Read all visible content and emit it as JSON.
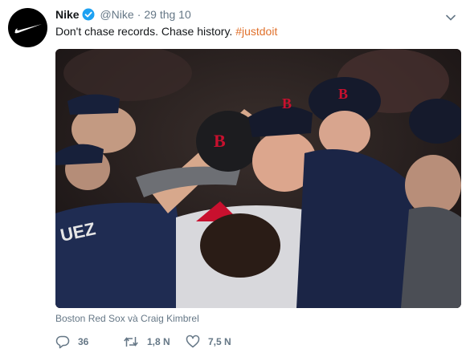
{
  "tweet": {
    "name": "Nike",
    "handle": "@Nike",
    "separator": "·",
    "time": "29 thg 10",
    "text_main": "Don't chase records. Chase history. ",
    "hashtag": "#justdoit",
    "caption": "Boston Red Sox và Craig Kimbrel",
    "replies": "36",
    "retweets": "1,8 N",
    "likes": "7,5 N"
  },
  "icons": {
    "avatar": "nike-swoosh-icon",
    "verified": "verified-badge-icon",
    "menu": "chevron-down-icon",
    "reply": "reply-icon",
    "retweet": "retweet-icon",
    "like": "heart-icon"
  },
  "colors": {
    "hashtag": "#e0712c",
    "verified": "#1da1f2",
    "muted": "#657786"
  }
}
